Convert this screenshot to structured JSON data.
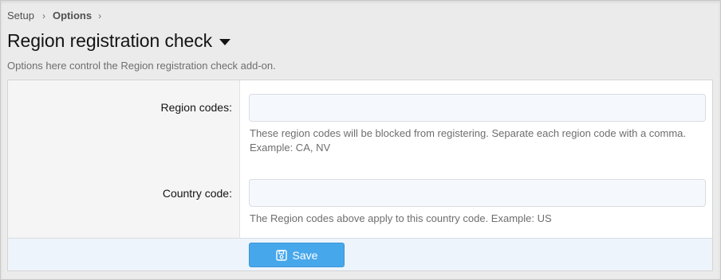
{
  "breadcrumb": {
    "items": [
      "Setup",
      "Options"
    ]
  },
  "header": {
    "title": "Region registration check",
    "description": "Options here control the Region registration check add-on."
  },
  "form": {
    "fields": [
      {
        "label": "Region codes:",
        "value": "",
        "hint_line1": "These region codes will be blocked from registering. Separate each region code with a comma.",
        "hint_line2": "Example: CA, NV"
      },
      {
        "label": "Country code:",
        "value": "",
        "hint_line1": "The Region codes above apply to this country code. Example: US"
      }
    ]
  },
  "footer": {
    "save_label": "Save",
    "save_icon": "floppy-disk-icon"
  },
  "colors": {
    "accent": "#47a7eb",
    "page_bg": "#ebebeb",
    "label_col_bg": "#f5f5f5",
    "input_bg": "#f5f9fd",
    "footer_bg": "#edf4fc"
  }
}
